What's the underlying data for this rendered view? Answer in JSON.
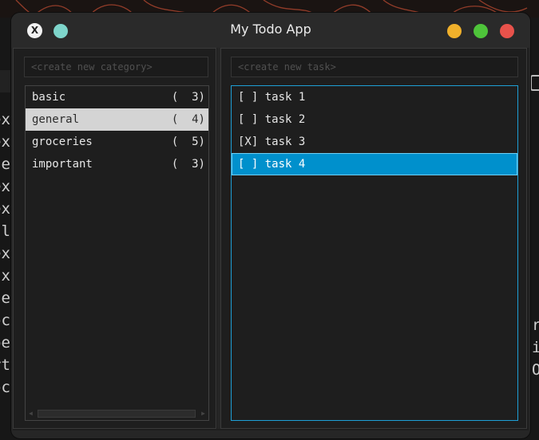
{
  "window": {
    "title": "My Todo App",
    "app_icon_glyph": "X"
  },
  "categories": {
    "placeholder": "<create new category>",
    "items": [
      {
        "name": "basic",
        "count": "(  3)",
        "selected": false
      },
      {
        "name": "general",
        "count": "(  4)",
        "selected": true
      },
      {
        "name": "groceries",
        "count": "(  5)",
        "selected": false
      },
      {
        "name": "important",
        "count": "(  3)",
        "selected": false
      }
    ]
  },
  "tasks": {
    "placeholder": "<create new task>",
    "items": [
      {
        "label": "[ ] task 1",
        "done": false,
        "selected": false
      },
      {
        "label": "[ ] task 2",
        "done": false,
        "selected": false
      },
      {
        "label": "[X] task 3",
        "done": true,
        "selected": false
      },
      {
        "label": "[ ] task 4",
        "done": false,
        "selected": true
      }
    ]
  },
  "background": {
    "left_fragments": [
      "ex",
      "ex",
      "fe",
      "ex",
      "ex",
      "ul",
      "ex",
      "fx",
      "te",
      "oc",
      "pe",
      "rt",
      "oc"
    ],
    "right_fragments": [
      "r",
      "i",
      "O"
    ]
  },
  "colors": {
    "accent": "#0090cc",
    "focus_border": "#1e9fd6",
    "selected_category_bg": "#d4d4d4",
    "close": "#e8524b",
    "minimize": "#f0b02b",
    "maximize": "#4ec43a"
  }
}
